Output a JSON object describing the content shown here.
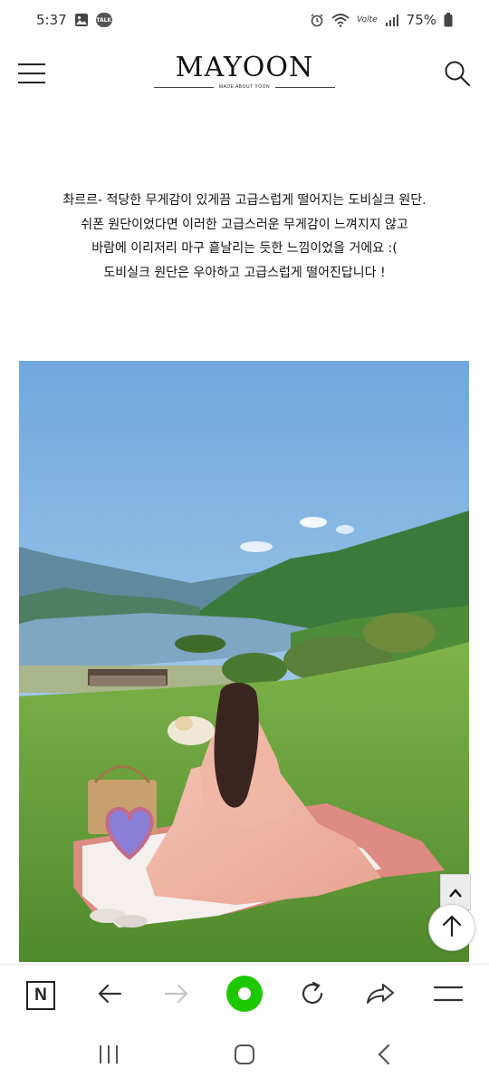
{
  "status_bar": {
    "time": "5:37",
    "talk_badge": "TALK",
    "network": "Volte",
    "battery": "75%",
    "icons": [
      "gallery-icon",
      "kakaotalk-icon",
      "alarm-icon",
      "wifi-icon",
      "signal-icon",
      "battery-icon"
    ]
  },
  "header": {
    "logo_title": "MAYOON",
    "logo_subtitle": "MADE ABOUT YOON",
    "icons": [
      "hamburger-menu-icon",
      "search-icon"
    ]
  },
  "description": {
    "lines": [
      "촤르르- 적당한 무게감이 있게끔 고급스럽게 떨어지는 도비실크 원단.",
      "쉬폰 원단이었다면 이러한 고급스러운 무게감이 느껴지지 않고",
      "바람에 이리저리 마구 흩날리는 듯한 느낌이었을 거에요 :(",
      "도비실크 원단은 우아하고 고급스럽게 떨어진답니다 !"
    ]
  },
  "photo": {
    "subject": "woman-in-pink-dress-on-picnic-blanket-lakeside-hills",
    "colors": {
      "sky": "#8fc1e8",
      "grass": "#6fa83e",
      "dress": "#f0b4a4",
      "blanket": "#dd8a82"
    }
  },
  "floating": {
    "icons": [
      "chevron-up-icon",
      "arrow-up-icon"
    ]
  },
  "browser_toolbar": {
    "icons": [
      "naver-n-icon",
      "back-arrow-icon",
      "forward-arrow-icon",
      "green-dot-icon",
      "refresh-icon",
      "share-icon",
      "menu-icon"
    ],
    "naver_letter": "N",
    "accent": "#1ec800"
  },
  "android_nav": {
    "icons": [
      "recent-apps-icon",
      "home-icon",
      "back-icon"
    ]
  }
}
